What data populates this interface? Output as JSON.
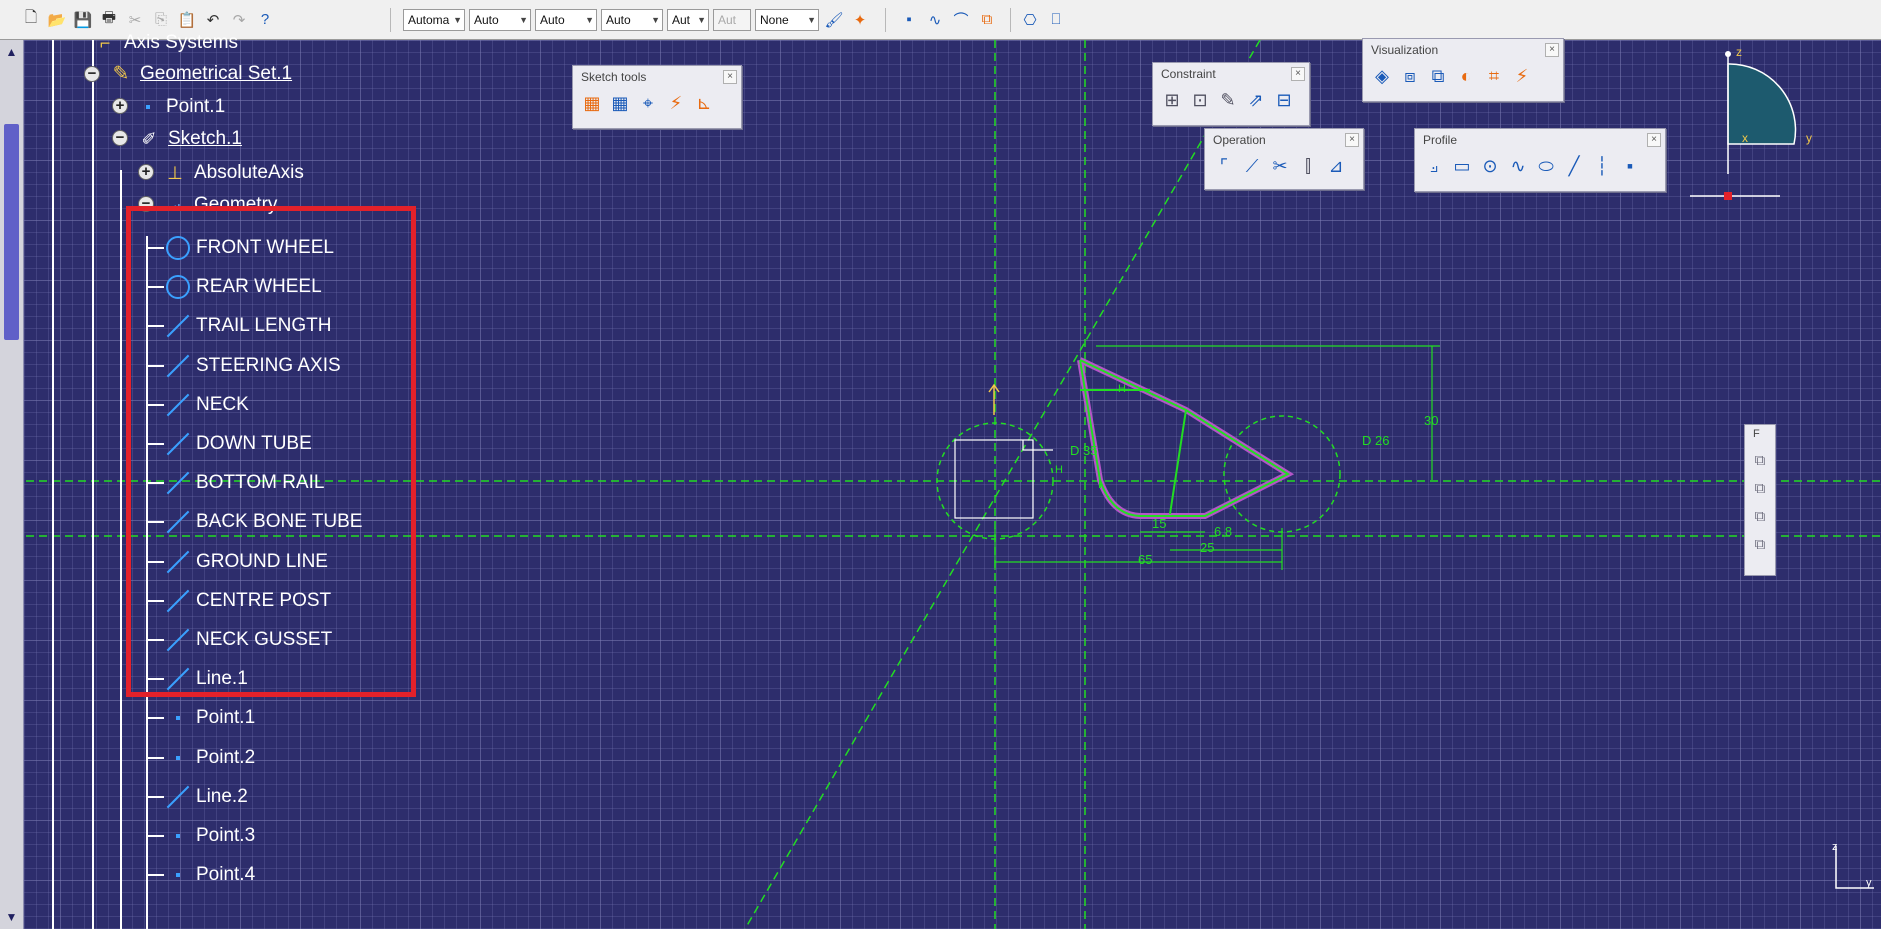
{
  "toolbar": {
    "icons": [
      "new-icon",
      "open-icon",
      "save-icon",
      "print-icon",
      "cut-icon",
      "copy-icon",
      "paste-icon",
      "undo-icon",
      "redo-icon",
      "whats-this-icon"
    ],
    "selects": [
      "Automa",
      "Auto",
      "Auto",
      "Auto",
      "Aut",
      "Aut",
      "None"
    ],
    "right_icons": [
      "point-icon",
      "spline-icon",
      "surface-icon",
      "measure-icon",
      "swap-icon",
      "render-icon"
    ]
  },
  "tree": {
    "axis_systems": "Axis Systems",
    "geometrical_set": "Geometrical Set.1",
    "point1": "Point.1",
    "sketch": "Sketch.1",
    "absolute_axis": "AbsoluteAxis",
    "geometry": "Geometry",
    "items": [
      {
        "label": "FRONT WHEEL",
        "icon": "circle-icon"
      },
      {
        "label": "REAR WHEEL",
        "icon": "circle-icon"
      },
      {
        "label": "TRAIL LENGTH",
        "icon": "line-icon"
      },
      {
        "label": "STEERING AXIS",
        "icon": "line-icon"
      },
      {
        "label": "NECK",
        "icon": "line-icon"
      },
      {
        "label": "DOWN TUBE",
        "icon": "line-icon"
      },
      {
        "label": "BOTTOM RAIL",
        "icon": "line-icon"
      },
      {
        "label": "BACK BONE TUBE",
        "icon": "line-icon"
      },
      {
        "label": "GROUND LINE",
        "icon": "line-icon"
      },
      {
        "label": "CENTRE POST",
        "icon": "line-icon"
      },
      {
        "label": "NECK GUSSET",
        "icon": "line-icon"
      },
      {
        "label": "Line.1",
        "icon": "line-icon"
      },
      {
        "label": "Point.1",
        "icon": "point-icon"
      },
      {
        "label": "Point.2",
        "icon": "point-icon"
      },
      {
        "label": "Line.2",
        "icon": "line-icon"
      },
      {
        "label": "Point.3",
        "icon": "point-icon"
      },
      {
        "label": "Point.4",
        "icon": "point-icon"
      }
    ]
  },
  "panels": {
    "sketch_tools": "Sketch tools",
    "constraint": "Constraint",
    "visualization": "Visualization",
    "operation": "Operation",
    "profile": "Profile",
    "side_label": "F"
  },
  "dimensions": {
    "d26": "D 26",
    "d_left": "D 35",
    "h30": "30",
    "w65": "65",
    "w25": "25",
    "w15": "15",
    "w68": "6.8",
    "h_label": "H"
  },
  "compass": {
    "z": "z",
    "x": "x",
    "y": "y"
  },
  "mini_axis": {
    "z": "z",
    "y": "y"
  },
  "colors": {
    "background": "#2d2d6c",
    "geometry": "#3aa0ff",
    "sketch_green": "#22dd22",
    "frame_purple": "#b455c8",
    "highlight": "#e3212a"
  }
}
